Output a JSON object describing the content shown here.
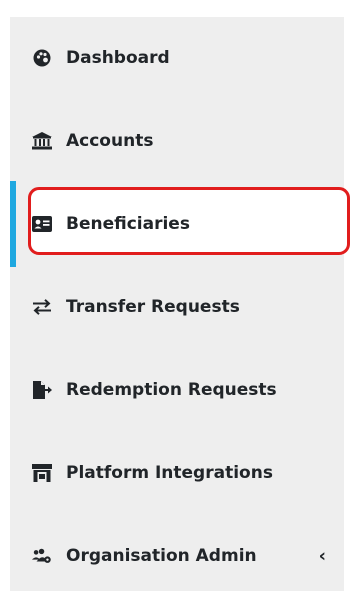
{
  "sidebar": {
    "items": [
      {
        "label": "Dashboard",
        "icon": "palette-icon"
      },
      {
        "label": "Accounts",
        "icon": "bank-icon"
      },
      {
        "label": "Beneficiaries",
        "icon": "id-card-icon",
        "active": true
      },
      {
        "label": "Transfer Requests",
        "icon": "transfer-arrows-icon"
      },
      {
        "label": "Redemption Requests",
        "icon": "file-export-icon"
      },
      {
        "label": "Platform Integrations",
        "icon": "store-icon"
      },
      {
        "label": "Organisation Admin",
        "icon": "users-cog-icon",
        "expander": "chevron-left-icon"
      }
    ],
    "expander_glyph": "‹"
  },
  "colors": {
    "sidebar_bg": "#eeeeee",
    "active_bar": "#1fa8e0",
    "highlight_border": "#e11d1d",
    "text": "#212529"
  }
}
